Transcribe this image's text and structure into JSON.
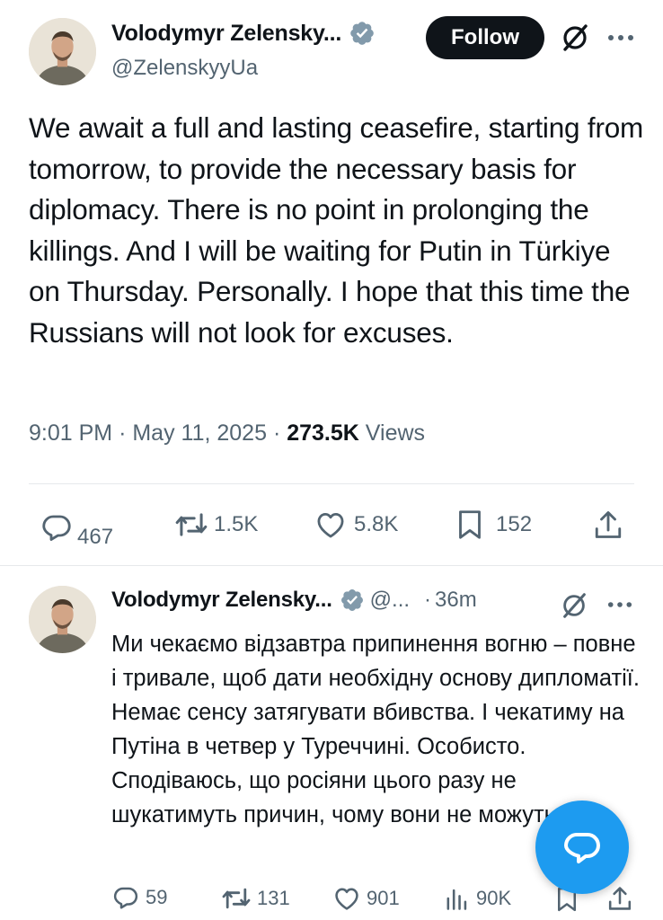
{
  "main_tweet": {
    "display_name": "Volodymyr Zelensky...",
    "handle": "@ZelenskyyUa",
    "follow_label": "Follow",
    "text": "We await a full and lasting ceasefire, starting from tomorrow, to provide the necessary basis for diplomacy. There is no point in prolonging the killings. And I will be waiting for Putin in Türkiye on Thursday. Personally. I hope that this time the Russians will not look for excuses.",
    "time": "9:01 PM",
    "date": "May 11, 2025",
    "views_count": "273.5K",
    "views_label": "Views",
    "replies": "467",
    "reposts": "1.5K",
    "likes": "5.8K",
    "bookmarks": "152"
  },
  "reply_tweet": {
    "display_name": "Volodymyr Zelensky...",
    "handle": "@...",
    "separator": "·",
    "time": "36m",
    "text": "Ми чекаємо відзавтра припинення вогню – повне і тривале, щоб дати необхідну основу дипломатії. Немає сенсу затягувати вбивства. І чекатиму на Путіна в четвер у Туреччині. Особисто. Сподіваюсь, що росіяни цього разу не шукатимуть причин, чому вони не можуть.",
    "replies": "59",
    "reposts": "131",
    "likes": "901",
    "views": "90K"
  },
  "meta_separator": "·",
  "colors": {
    "text": "#0f1419",
    "secondary": "#536471",
    "accent": "#1d9bf0",
    "verified": "#829aab",
    "follow_bg": "#0f1419"
  },
  "icons": [
    "verified-icon",
    "grok-icon",
    "more-icon",
    "reply-icon",
    "retweet-icon",
    "like-icon",
    "bookmark-icon",
    "share-icon",
    "views-icon",
    "compose-chat-icon"
  ]
}
